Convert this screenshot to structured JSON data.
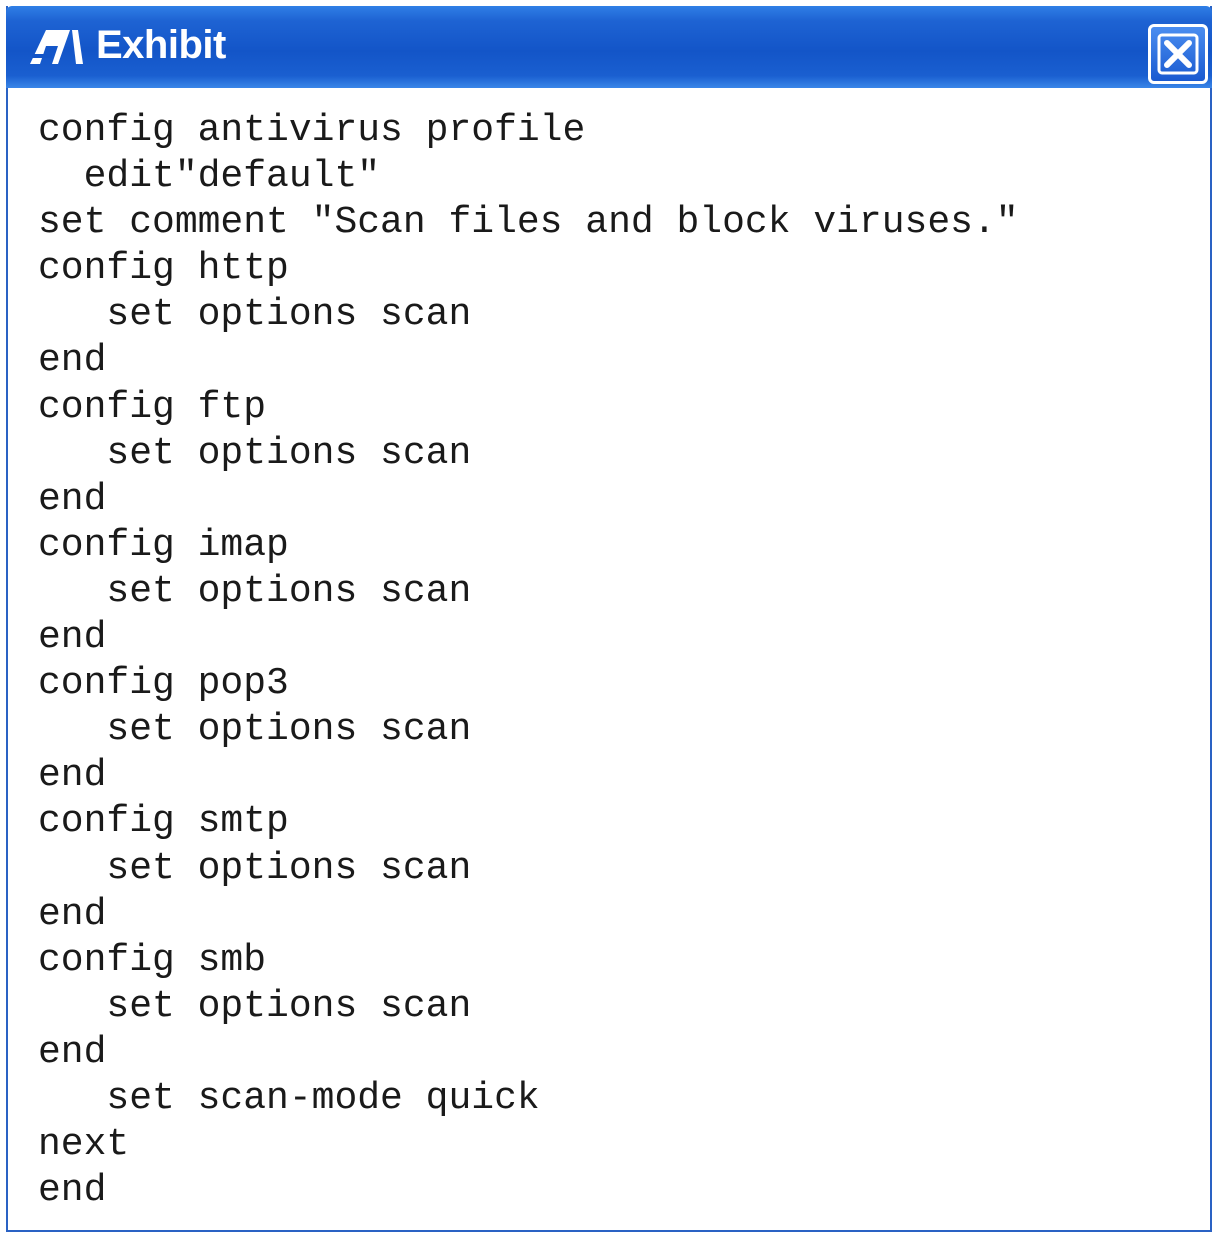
{
  "window": {
    "title": "Exhibit"
  },
  "code": {
    "lines": [
      "config antivirus profile",
      "  edit\"default\"",
      "set comment \"Scan files and block viruses.\"",
      "config http",
      "   set options scan",
      "end",
      "config ftp",
      "   set options scan",
      "end",
      "config imap",
      "   set options scan",
      "end",
      "config pop3",
      "   set options scan",
      "end",
      "config smtp",
      "   set options scan",
      "end",
      "config smb",
      "   set options scan",
      "end",
      "   set scan-mode quick",
      "next",
      "end"
    ]
  },
  "colors": {
    "titlebar": "#1355c8",
    "border": "#2a62c4",
    "text": "#1a1a1a"
  },
  "icons": {
    "title": "exhibit-icon",
    "close": "close-icon"
  }
}
